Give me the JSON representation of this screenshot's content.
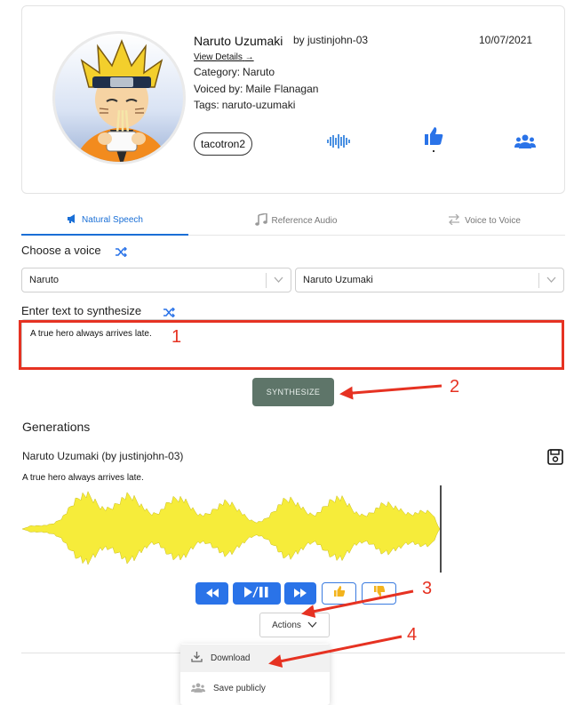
{
  "voice_card": {
    "name": "Naruto Uzumaki",
    "author": "by justinjohn-03",
    "date": "10/07/2021",
    "view_details": "View Details",
    "category_label": "Category:",
    "category_value": "Naruto",
    "voiced_by_label": "Voiced by:",
    "voiced_by_value": "Maile Flanagan",
    "tags_label": "Tags:",
    "tags_value": "naruto-uzumaki",
    "model": "tacotron2",
    "icons": [
      "audio-wave-icon",
      "thumbs-up-icon",
      "users-icon"
    ]
  },
  "tabs": [
    {
      "label": "Natural Speech",
      "icon": "megaphone-icon",
      "active": true
    },
    {
      "label": "Reference Audio",
      "icon": "music-note-icon",
      "active": false
    },
    {
      "label": "Voice to Voice",
      "icon": "swap-arrows-icon",
      "active": false
    }
  ],
  "choose_voice": {
    "label": "Choose a voice",
    "category_select": "Naruto",
    "voice_select": "Naruto Uzumaki"
  },
  "synth": {
    "label": "Enter text to synthesize",
    "text": "A true hero always arrives late.",
    "button": "SYNTHESIZE"
  },
  "generations": {
    "title": "Generations",
    "items": [
      {
        "name": "Naruto Uzumaki (by justinjohn-03)",
        "text": "A true hero always arrives late."
      }
    ],
    "actions_label": "Actions",
    "menu": [
      "Download",
      "Save publicly"
    ]
  },
  "annotations": [
    "1",
    "2",
    "3",
    "4"
  ],
  "colors": {
    "accent": "#1a6fd6",
    "button_blue": "#2a73e8",
    "synthesize_bg": "#5e7569",
    "waveform": "#f6ec3a",
    "annotation_red": "#e63222"
  }
}
